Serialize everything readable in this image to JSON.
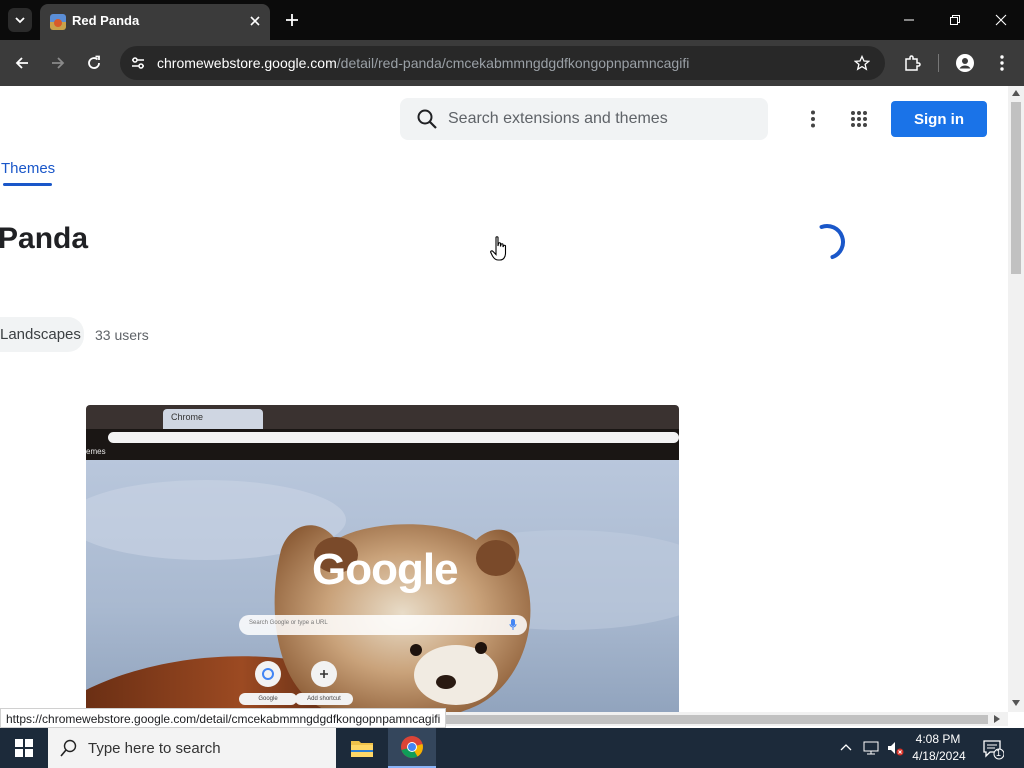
{
  "browser": {
    "tab_title": "Red Panda",
    "url_host": "chromewebstore.google.com",
    "url_path": "/detail/red-panda/cmcekabmmngdgdfkongopnpamncagifi"
  },
  "header": {
    "search_placeholder": "Search extensions and themes",
    "sign_in_label": "Sign in"
  },
  "nav": {
    "active_tab": "Themes"
  },
  "item": {
    "title": "Panda",
    "category": "Landscapes",
    "users": "33 users"
  },
  "preview": {
    "tab_label": "Chrome",
    "bookmarks_label": "emes",
    "logo_text": "Google",
    "search_placeholder": "Search Google or type a URL",
    "shortcut1_label": "Google",
    "shortcut2_label": "Add shortcut"
  },
  "status_bar": {
    "url": "https://chromewebstore.google.com/detail/cmcekabmmngdgdfkongopnpamncagifi"
  },
  "taskbar": {
    "search_placeholder": "Type here to search",
    "time": "4:08 PM",
    "date": "4/18/2024",
    "notification_count": "1"
  },
  "colors": {
    "accent": "#1a73e8",
    "nav_active": "#1a57c9"
  }
}
